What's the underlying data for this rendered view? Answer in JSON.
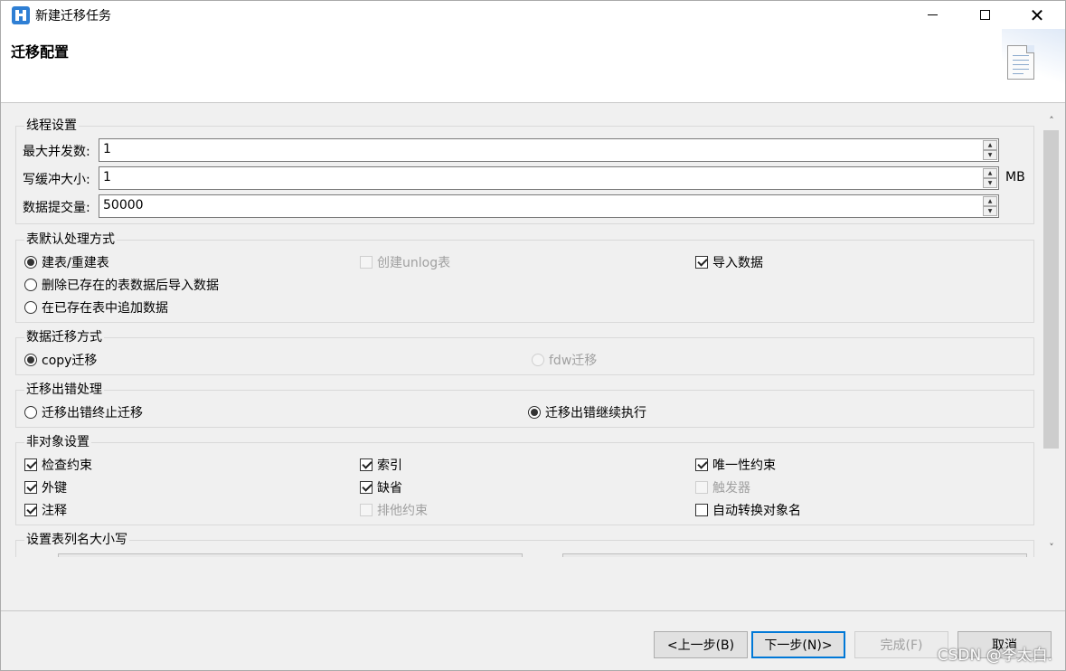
{
  "window": {
    "title": "新建迁移任务"
  },
  "header": {
    "title": "迁移配置"
  },
  "thread_settings": {
    "title": "线程设置",
    "max_concurrency": {
      "label": "最大并发数:",
      "value": "1"
    },
    "write_buffer": {
      "label": "写缓冲大小:",
      "value": "1",
      "unit": "MB"
    },
    "commit_size": {
      "label": "数据提交量:",
      "value": "50000"
    }
  },
  "table_default": {
    "title": "表默认处理方式",
    "options": [
      {
        "label": "建表/重建表",
        "selected": true
      },
      {
        "label": "删除已存在的表数据后导入数据",
        "selected": false
      },
      {
        "label": "在已存在表中追加数据",
        "selected": false
      }
    ],
    "create_unlog": {
      "label": "创建unlog表",
      "checked": false,
      "enabled": false
    },
    "import_data": {
      "label": "导入数据",
      "checked": true
    }
  },
  "migration_method": {
    "title": "数据迁移方式",
    "copy": {
      "label": "copy迁移",
      "selected": true
    },
    "fdw": {
      "label": "fdw迁移",
      "selected": false,
      "enabled": false
    }
  },
  "error_handling": {
    "title": "迁移出错处理",
    "stop": {
      "label": "迁移出错终止迁移",
      "selected": false
    },
    "continue": {
      "label": "迁移出错继续执行",
      "selected": true
    }
  },
  "non_object": {
    "title": "非对象设置",
    "items": [
      {
        "label": "检查约束",
        "checked": true,
        "enabled": true
      },
      {
        "label": "索引",
        "checked": true,
        "enabled": true
      },
      {
        "label": "唯一性约束",
        "checked": true,
        "enabled": true
      },
      {
        "label": "外键",
        "checked": true,
        "enabled": true
      },
      {
        "label": "缺省",
        "checked": true,
        "enabled": true
      },
      {
        "label": "触发器",
        "checked": false,
        "enabled": false
      },
      {
        "label": "注释",
        "checked": true,
        "enabled": true
      },
      {
        "label": "排他约束",
        "checked": false,
        "enabled": false
      },
      {
        "label": "自动转换对象名",
        "checked": false,
        "enabled": true
      }
    ]
  },
  "case_settings": {
    "title": "设置表列名大小写"
  },
  "footer": {
    "back": "<上一步(B)",
    "next": "下一步(N)>",
    "finish": "完成(F)",
    "cancel": "取消"
  },
  "watermark": "CSDN @李太白."
}
